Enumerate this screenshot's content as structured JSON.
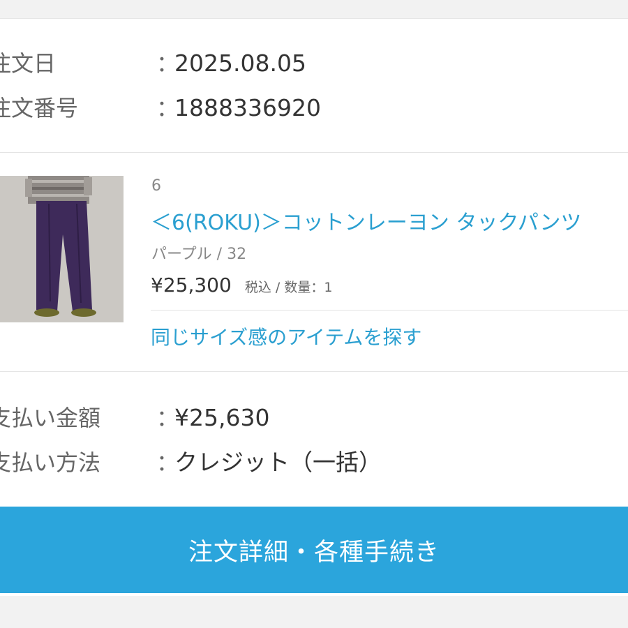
{
  "order_info": {
    "date_label": "注文日",
    "date_value": "2025.08.05",
    "number_label": "注文番号",
    "number_value": "1888336920",
    "colon": "："
  },
  "item": {
    "brand": "6",
    "name": "＜6(ROKU)＞コットンレーヨン タックパンツ",
    "variant": "パープル / 32",
    "price": "¥25,300",
    "tax_qty": "税込 / 数量：1",
    "similar_link": "同じサイズ感のアイテムを探す"
  },
  "payment": {
    "amount_label": "支払い金額",
    "amount_value": "¥25,630",
    "method_label": "支払い方法",
    "method_value": "クレジット（一括）"
  },
  "cta": {
    "label": "注文詳細・各種手続き"
  },
  "colors": {
    "accent": "#2ba5dc",
    "link": "#2a9fd0",
    "pants": "#3e2a5a"
  }
}
